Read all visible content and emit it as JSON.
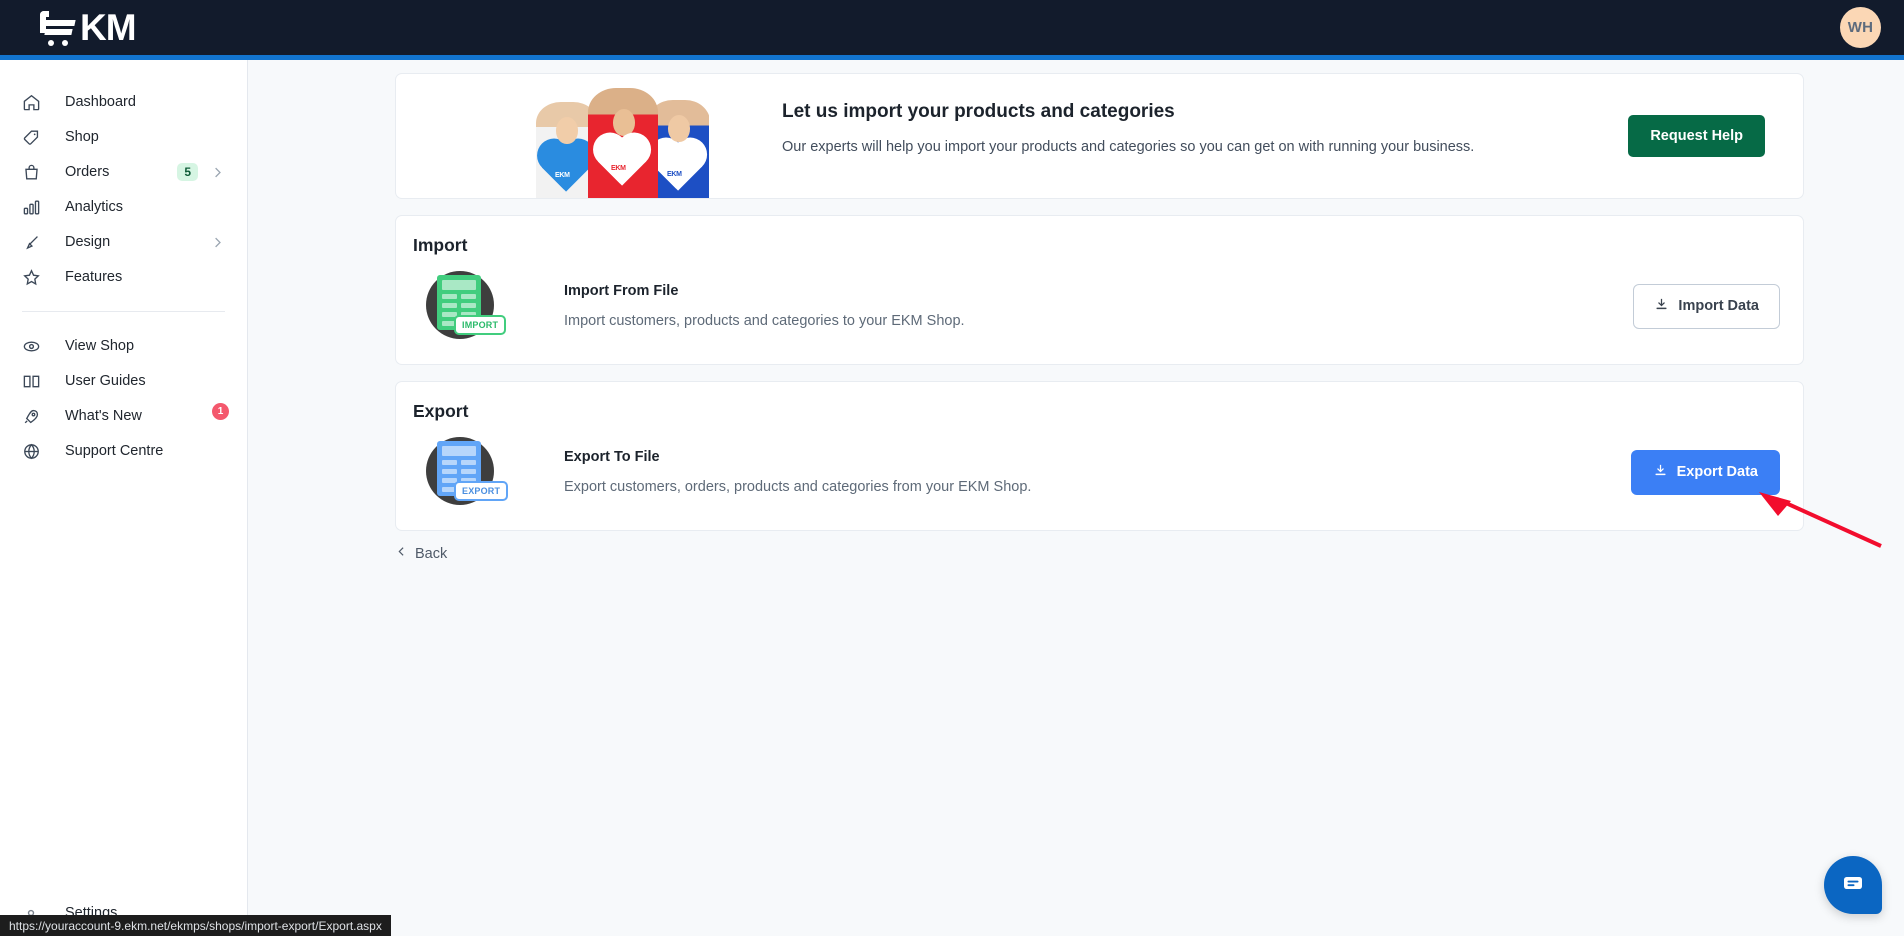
{
  "topbar": {
    "logo_text": "KM",
    "logo_icon": "shopping-cart-icon",
    "avatar_initials": "WH"
  },
  "sidebar": {
    "primary_items": [
      {
        "id": "dashboard",
        "label": "Dashboard",
        "icon": "home-icon"
      },
      {
        "id": "shop",
        "label": "Shop",
        "icon": "tag-icon"
      },
      {
        "id": "orders",
        "label": "Orders",
        "icon": "bag-icon",
        "badge": "5",
        "chevron": true
      },
      {
        "id": "analytics",
        "label": "Analytics",
        "icon": "bar-chart-icon"
      },
      {
        "id": "design",
        "label": "Design",
        "icon": "brush-icon",
        "chevron": true
      },
      {
        "id": "features",
        "label": "Features",
        "icon": "star-icon"
      }
    ],
    "secondary_items": [
      {
        "id": "view-shop",
        "label": "View Shop",
        "icon": "eye-icon"
      },
      {
        "id": "user-guides",
        "label": "User Guides",
        "icon": "book-icon"
      },
      {
        "id": "whats-new",
        "label": "What's New",
        "icon": "rocket-icon",
        "badge": "1"
      },
      {
        "id": "support-centre",
        "label": "Support Centre",
        "icon": "globe-icon"
      }
    ],
    "settings": {
      "label": "Settings",
      "icon": "gear-icon"
    }
  },
  "hero": {
    "title": "Let us import your products and categories",
    "subtitle": "Our experts will help you import your products and categories so you can get on with running your business.",
    "cta_label": "Request Help",
    "cta_color": "#066a46",
    "image_alt": "three-models-wearing-ekm-heart-tshirts",
    "tee_marks": [
      "EKM",
      "EKM",
      "EKM"
    ]
  },
  "import_section": {
    "title": "Import",
    "icon_tag": "IMPORT",
    "icon_color": "#41cd7e",
    "row_title": "Import From File",
    "row_desc": "Import customers, products and categories to your EKM Shop.",
    "button_label": "Import Data",
    "button_icon": "download-icon"
  },
  "export_section": {
    "title": "Export",
    "icon_tag": "EXPORT",
    "icon_color": "#61a5f7",
    "row_title": "Export To File",
    "row_desc": "Export customers, orders, products and categories from your EKM Shop.",
    "button_label": "Export Data",
    "button_icon": "download-icon",
    "button_color": "#3b7ff5"
  },
  "back_link": {
    "label": "Back",
    "icon": "chevron-left-icon"
  },
  "chat_widget": {
    "icon": "chat-bubble-icon",
    "color": "#0b66c2"
  },
  "annotation": {
    "type": "red-arrow",
    "color": "#f20d2d",
    "points_to": "Export Data"
  },
  "status_bar": {
    "url": "https://youraccount-9.ekm.net/ekmps/shops/import-export/Export.aspx"
  }
}
